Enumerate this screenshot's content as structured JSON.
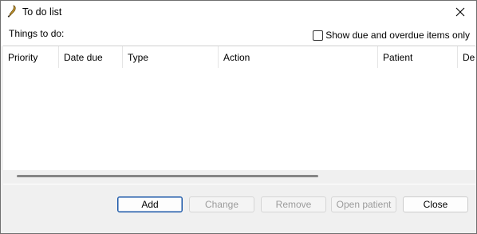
{
  "window": {
    "title": "To do list"
  },
  "filter": {
    "things_label": "Things to do:",
    "show_due_label": "Show due and overdue items only",
    "show_due_checked": false
  },
  "list": {
    "columns": [
      "Priority",
      "Date due",
      "Type",
      "Action",
      "Patient",
      "De"
    ],
    "rows": []
  },
  "buttons": {
    "add": "Add",
    "change": "Change",
    "remove": "Remove",
    "open_patient": "Open patient",
    "close": "Close"
  }
}
